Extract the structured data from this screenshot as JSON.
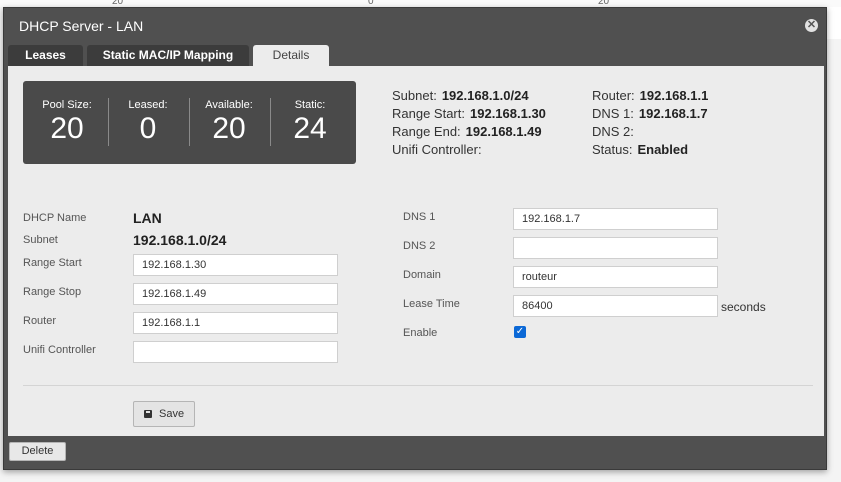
{
  "background": {
    "ticks": [
      "20",
      "0",
      "20"
    ]
  },
  "dialog": {
    "title": "DHCP Server - LAN"
  },
  "tabs": [
    {
      "label": "Leases",
      "active": false
    },
    {
      "label": "Static MAC/IP Mapping",
      "active": false
    },
    {
      "label": "Details",
      "active": true
    }
  ],
  "stats": [
    {
      "label": "Pool Size:",
      "value": "20"
    },
    {
      "label": "Leased:",
      "value": "0"
    },
    {
      "label": "Available:",
      "value": "20"
    },
    {
      "label": "Static:",
      "value": "24"
    }
  ],
  "summary": {
    "subnet": {
      "label": "Subnet:",
      "value": "192.168.1.0/24"
    },
    "range_start": {
      "label": "Range Start:",
      "value": "192.168.1.30"
    },
    "range_end": {
      "label": "Range End:",
      "value": "192.168.1.49"
    },
    "unifi_controller": {
      "label": "Unifi Controller:",
      "value": ""
    },
    "router": {
      "label": "Router:",
      "value": "192.168.1.1"
    },
    "dns1": {
      "label": "DNS 1:",
      "value": "192.168.1.7"
    },
    "dns2": {
      "label": "DNS 2:",
      "value": ""
    },
    "status": {
      "label": "Status:",
      "value": "Enabled"
    }
  },
  "form": {
    "dhcp_name": {
      "label": "DHCP Name",
      "value": "LAN"
    },
    "subnet": {
      "label": "Subnet",
      "value": "192.168.1.0/24"
    },
    "range_start": {
      "label": "Range Start",
      "value": "192.168.1.30"
    },
    "range_stop": {
      "label": "Range Stop",
      "value": "192.168.1.49"
    },
    "router": {
      "label": "Router",
      "value": "192.168.1.1"
    },
    "unifi_controller": {
      "label": "Unifi Controller",
      "value": ""
    },
    "dns1": {
      "label": "DNS 1",
      "value": "192.168.1.7"
    },
    "dns2": {
      "label": "DNS 2",
      "value": ""
    },
    "domain": {
      "label": "Domain",
      "value": "routeur"
    },
    "lease_time": {
      "label": "Lease Time",
      "value": "86400",
      "suffix": "seconds"
    },
    "enable": {
      "label": "Enable",
      "checked": true
    }
  },
  "buttons": {
    "save": "Save",
    "delete": "Delete"
  },
  "colors": {
    "dialog_frame": "#505050",
    "panel": "#ececec",
    "checkbox": "#0b68d6"
  }
}
